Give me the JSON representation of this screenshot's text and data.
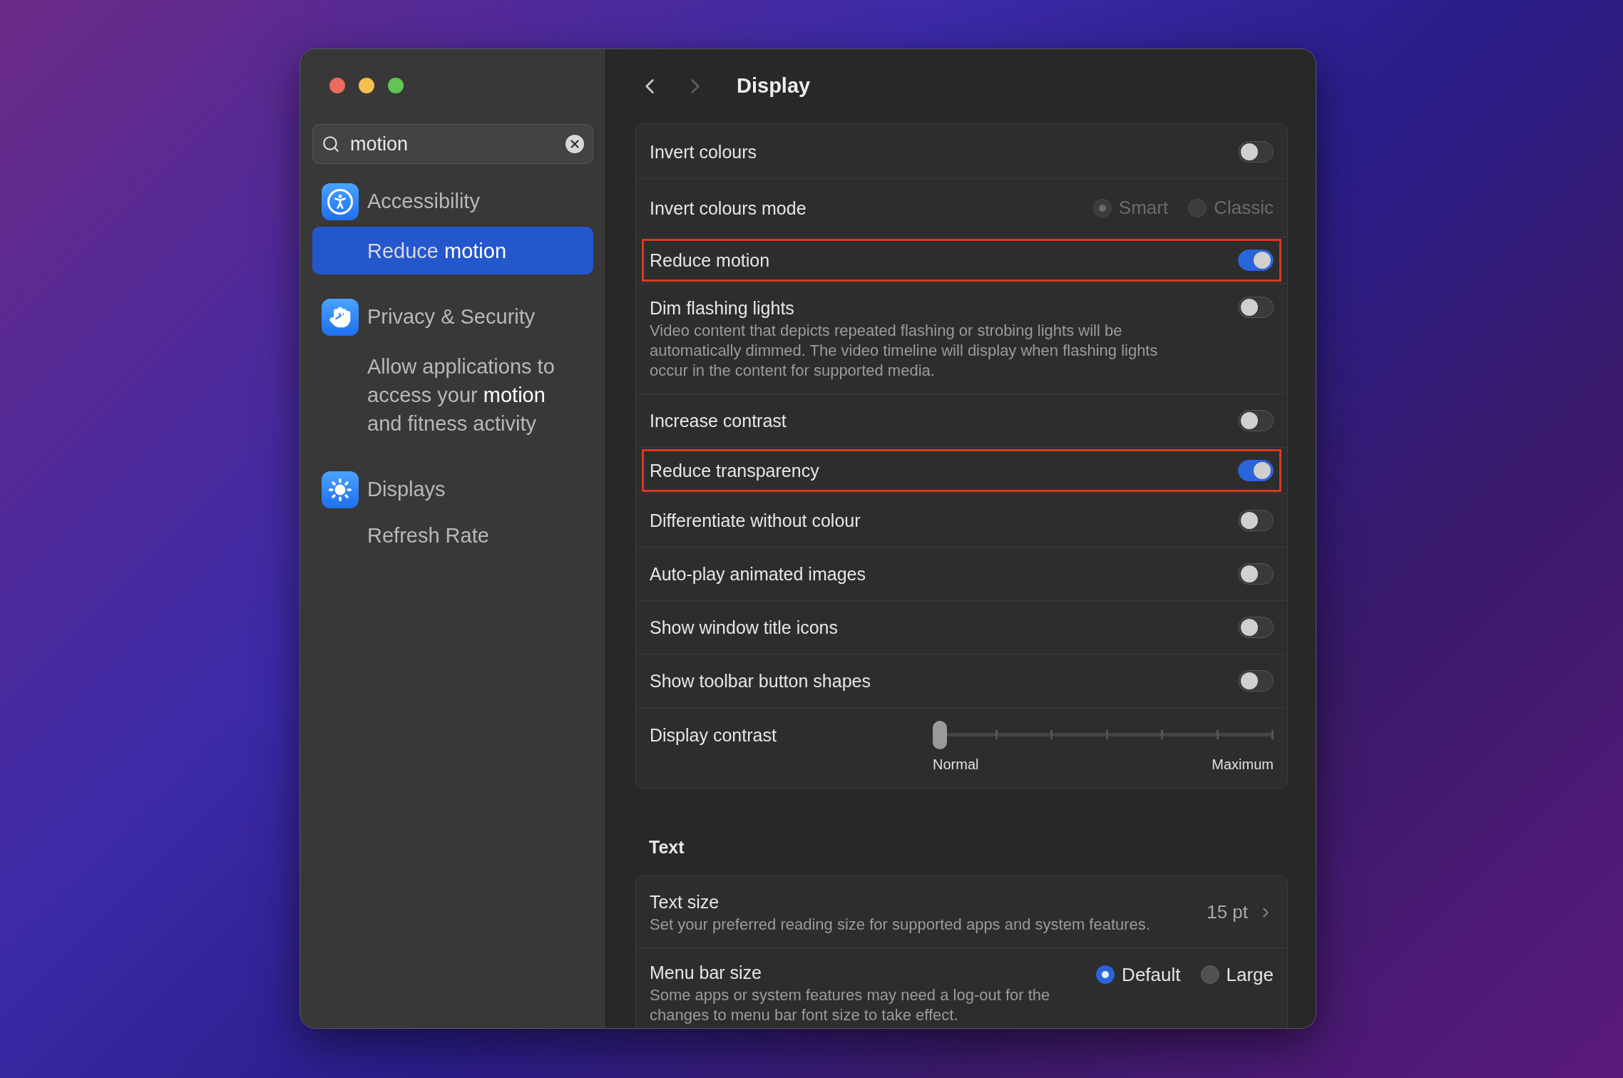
{
  "window": {
    "title": "Display"
  },
  "navigation": {
    "back_enabled": true,
    "forward_enabled": false
  },
  "search": {
    "value": "motion"
  },
  "sidebar": {
    "items": [
      {
        "kind": "category",
        "label": "Accessibility",
        "selected": false
      },
      {
        "kind": "result",
        "label": "Reduce **motion**",
        "selected": true
      },
      {
        "kind": "category",
        "label": "Privacy & Security",
        "selected": false
      },
      {
        "kind": "result",
        "label": "Allow applications to access your **motion** and fitness activity",
        "selected": false
      },
      {
        "kind": "category",
        "label": "Displays",
        "selected": false
      },
      {
        "kind": "result",
        "label": "Refresh Rate",
        "selected": false
      }
    ]
  },
  "sections": [
    {
      "rows": [
        {
          "kind": "toggle",
          "label": "Invert colours",
          "on": false,
          "highlighted": false
        },
        {
          "kind": "radio",
          "label": "Invert colours mode",
          "disabled": true,
          "highlighted": false,
          "options": [
            {
              "label": "Smart",
              "selected": true
            },
            {
              "label": "Classic",
              "selected": false
            }
          ]
        },
        {
          "kind": "toggle",
          "label": "Reduce motion",
          "on": true,
          "highlighted": true
        },
        {
          "kind": "toggle",
          "label": "Dim flashing lights",
          "description": "Video content that depicts repeated flashing or strobing lights will be automatically dimmed. The video timeline will display when flashing lights occur in the content for supported media.",
          "on": false,
          "highlighted": false
        },
        {
          "kind": "toggle",
          "label": "Increase contrast",
          "on": false,
          "highlighted": false
        },
        {
          "kind": "toggle",
          "label": "Reduce transparency",
          "on": true,
          "highlighted": true
        },
        {
          "kind": "toggle",
          "label": "Differentiate without colour",
          "on": false,
          "highlighted": false
        },
        {
          "kind": "toggle",
          "label": "Auto-play animated images",
          "on": false,
          "highlighted": false
        },
        {
          "kind": "toggle",
          "label": "Show window title icons",
          "on": false,
          "highlighted": false
        },
        {
          "kind": "toggle",
          "label": "Show toolbar button shapes",
          "on": false,
          "highlighted": false
        },
        {
          "kind": "slider",
          "label": "Display contrast",
          "level": 0,
          "min_label": "Normal",
          "max_label": "Maximum",
          "highlighted": false
        }
      ]
    },
    {
      "heading": "Text",
      "rows": [
        {
          "kind": "value",
          "label": "Text size",
          "description": "Set your preferred reading size for supported apps and system features.",
          "value": "15 pt",
          "highlighted": false
        },
        {
          "kind": "radio",
          "label": "Menu bar size",
          "description": "Some apps or system features may need a log-out for the changes to menu bar font size to take effect.",
          "disabled": false,
          "highlighted": false,
          "options": [
            {
              "label": "Default",
              "selected": true
            },
            {
              "label": "Large",
              "selected": false
            }
          ]
        }
      ]
    }
  ]
}
